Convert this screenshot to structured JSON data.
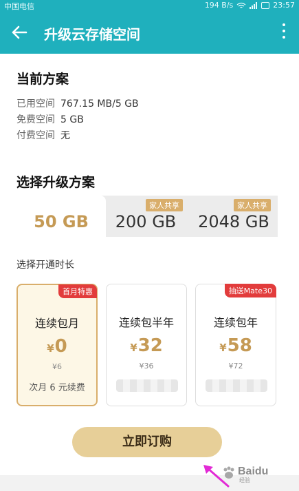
{
  "status_bar": {
    "carrier": "中国电信",
    "speed": "194 B/s",
    "time": "23:57"
  },
  "app_bar": {
    "title": "升级云存储空间",
    "icons": [
      "arrow-left-icon",
      "more-vertical-icon"
    ]
  },
  "current_plan": {
    "title": "当前方案",
    "rows": [
      {
        "label": "已用空间",
        "value": "767.15 MB/5 GB"
      },
      {
        "label": "免费空间",
        "value": "5 GB"
      },
      {
        "label": "付费空间",
        "value": "无"
      }
    ]
  },
  "upgrade": {
    "title": "选择升级方案",
    "tabs": [
      {
        "label": "50 GB",
        "tag": ""
      },
      {
        "label": "200 GB",
        "tag": "家人共享"
      },
      {
        "label": "2048 GB",
        "tag": "家人共享"
      }
    ],
    "selected_tab": 0
  },
  "duration": {
    "label": "选择开通时长",
    "options": [
      {
        "name": "连续包月",
        "currency": "¥",
        "price": "0",
        "original": "¥6",
        "note": "次月 6 元续费",
        "badge": "首月特惠"
      },
      {
        "name": "连续包半年",
        "currency": "¥",
        "price": "32",
        "original": "¥36",
        "note": "",
        "badge": ""
      },
      {
        "name": "连续包年",
        "currency": "¥",
        "price": "58",
        "original": "¥72",
        "note": "",
        "badge": "抽送Mate30"
      }
    ],
    "selected_option": 0
  },
  "buy_button": "立即订购",
  "watermark": {
    "brand": "Baidu",
    "sub": "经验"
  },
  "colors": {
    "primary": "#1fb0bd",
    "gold": "#c59a55",
    "tag_gold": "#d9ae6b",
    "badge_red": "#e23c3c",
    "button": "#e7cf98",
    "arrow": "#e22ad5"
  }
}
